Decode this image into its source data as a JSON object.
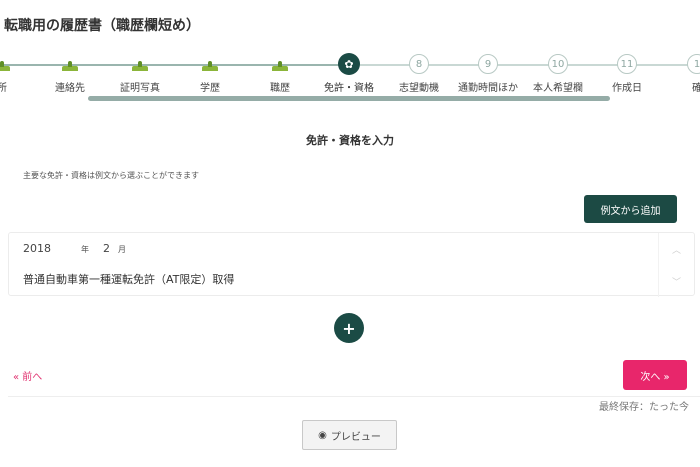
{
  "page": {
    "title": "転職用の履歴書（職歴欄短め）"
  },
  "stepper": {
    "steps": [
      {
        "label": "所",
        "state": "done",
        "num": ""
      },
      {
        "label": "連絡先",
        "state": "done",
        "num": ""
      },
      {
        "label": "証明写真",
        "state": "done",
        "num": ""
      },
      {
        "label": "学歴",
        "state": "done",
        "num": ""
      },
      {
        "label": "職歴",
        "state": "done",
        "num": ""
      },
      {
        "label": "免許・資格",
        "state": "current",
        "num": ""
      },
      {
        "label": "志望動機",
        "state": "todo",
        "num": "8"
      },
      {
        "label": "通勤時間ほか",
        "state": "todo",
        "num": "9"
      },
      {
        "label": "本人希望欄",
        "state": "todo",
        "num": "10"
      },
      {
        "label": "作成日",
        "state": "todo",
        "num": "11"
      },
      {
        "label": "確",
        "state": "todo",
        "num": "1"
      }
    ]
  },
  "section": {
    "title": "免許・資格を入力",
    "hint": "主要な免許・資格は例文から選ぶことができます"
  },
  "buttons": {
    "add_example": "例文から追加",
    "add_row": "+",
    "prev": "« 前へ",
    "next": "次へ »",
    "preview": "プレビュー"
  },
  "entry": {
    "year": "2018",
    "year_unit": "年",
    "month": "2",
    "month_unit": "月",
    "text": "普通自動車第一種運転免許（AT限定）取得"
  },
  "status": {
    "save": "最終保存：たった今"
  },
  "colors": {
    "primary": "#1b4b45",
    "accent": "#e8266b",
    "grass": "#8bb53a"
  }
}
